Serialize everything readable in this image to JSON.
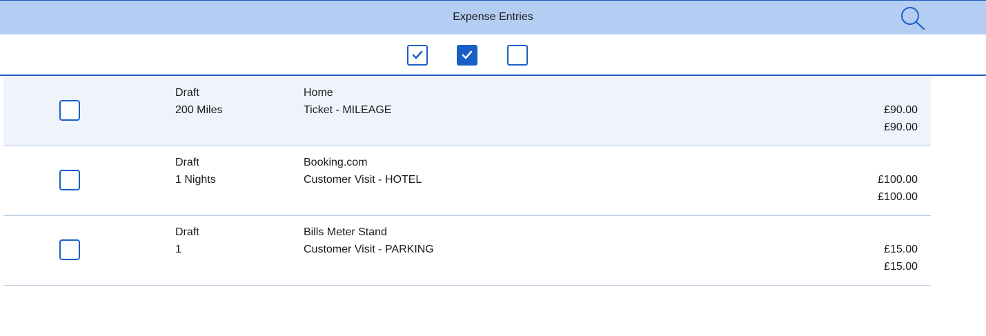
{
  "header": {
    "title": "Expense Entries",
    "search_icon": "search-icon"
  },
  "filters": [
    {
      "name": "outline-checked",
      "state": "checked-outline"
    },
    {
      "name": "filled-checked",
      "state": "checked-filled"
    },
    {
      "name": "unchecked",
      "state": "unchecked"
    }
  ],
  "entries": [
    {
      "status": "Draft",
      "quantity": "200 Miles",
      "merchant": "Home",
      "description": "Ticket - MILEAGE",
      "amount": "£90.00",
      "total": "£90.00",
      "selected": true
    },
    {
      "status": "Draft",
      "quantity": "1 Nights",
      "merchant": "Booking.com",
      "description": "Customer Visit - HOTEL",
      "amount": "£100.00",
      "total": "£100.00",
      "selected": false
    },
    {
      "status": "Draft",
      "quantity": "1",
      "merchant": "Bills Meter Stand",
      "description": "Customer Visit - PARKING",
      "amount": "£15.00",
      "total": "£15.00",
      "selected": false
    }
  ],
  "colors": {
    "header_bg": "#b4cdf2",
    "accent": "#1a5fc7",
    "selected_row_bg": "#eef3fc",
    "divider": "#b8cbe0"
  }
}
